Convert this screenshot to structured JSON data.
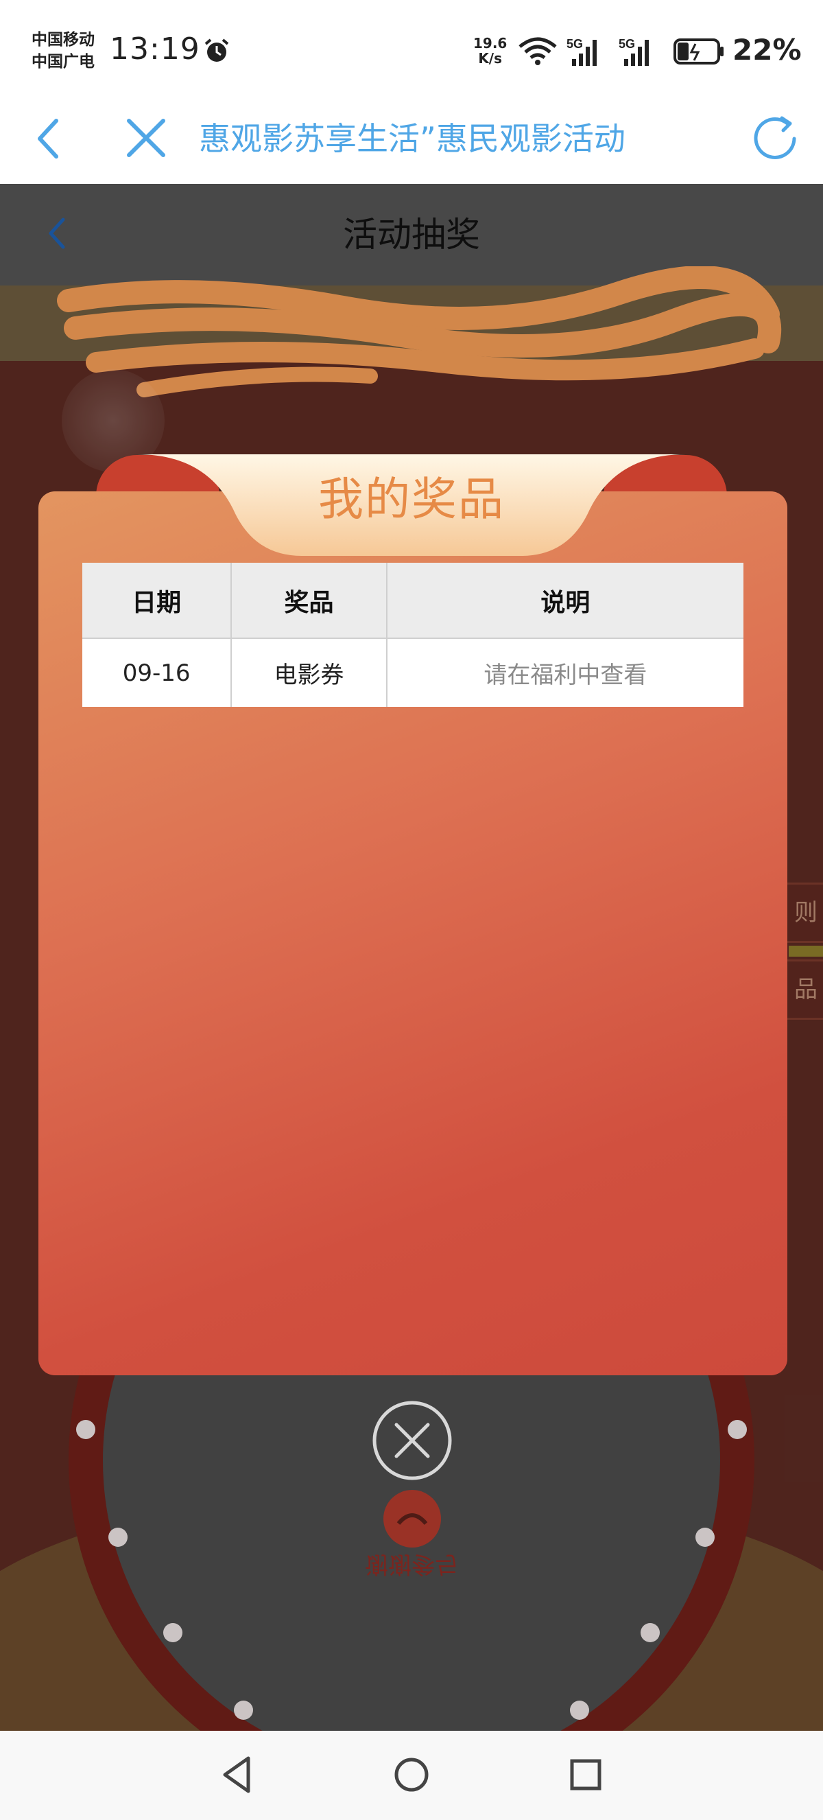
{
  "status_bar": {
    "carrier_1": "中国移动",
    "carrier_2": "中国广电",
    "time": "13:19",
    "net_speed_value": "19.6",
    "net_speed_unit": "K/s",
    "sim_1_tag": "5G",
    "sim_2_tag": "5G",
    "battery": "22%"
  },
  "browser": {
    "title": "惠观影苏享生活”惠民观影活动"
  },
  "page": {
    "header_title": "活动抽奖",
    "side_tab_1": "则",
    "side_tab_2": "品",
    "wheel_text": "谢谢参与"
  },
  "modal": {
    "title": "我的奖品",
    "table": {
      "headers": [
        "日期",
        "奖品",
        "说明"
      ],
      "rows": [
        {
          "date": "09-16",
          "prize": "电影券",
          "note": "请在福利中查看"
        }
      ]
    }
  },
  "colors": {
    "accent_blue": "#4fa6e6",
    "modal_title": "#e68a46",
    "modal_gradient_start": "#e39560",
    "modal_gradient_end": "#cd4a3c"
  }
}
